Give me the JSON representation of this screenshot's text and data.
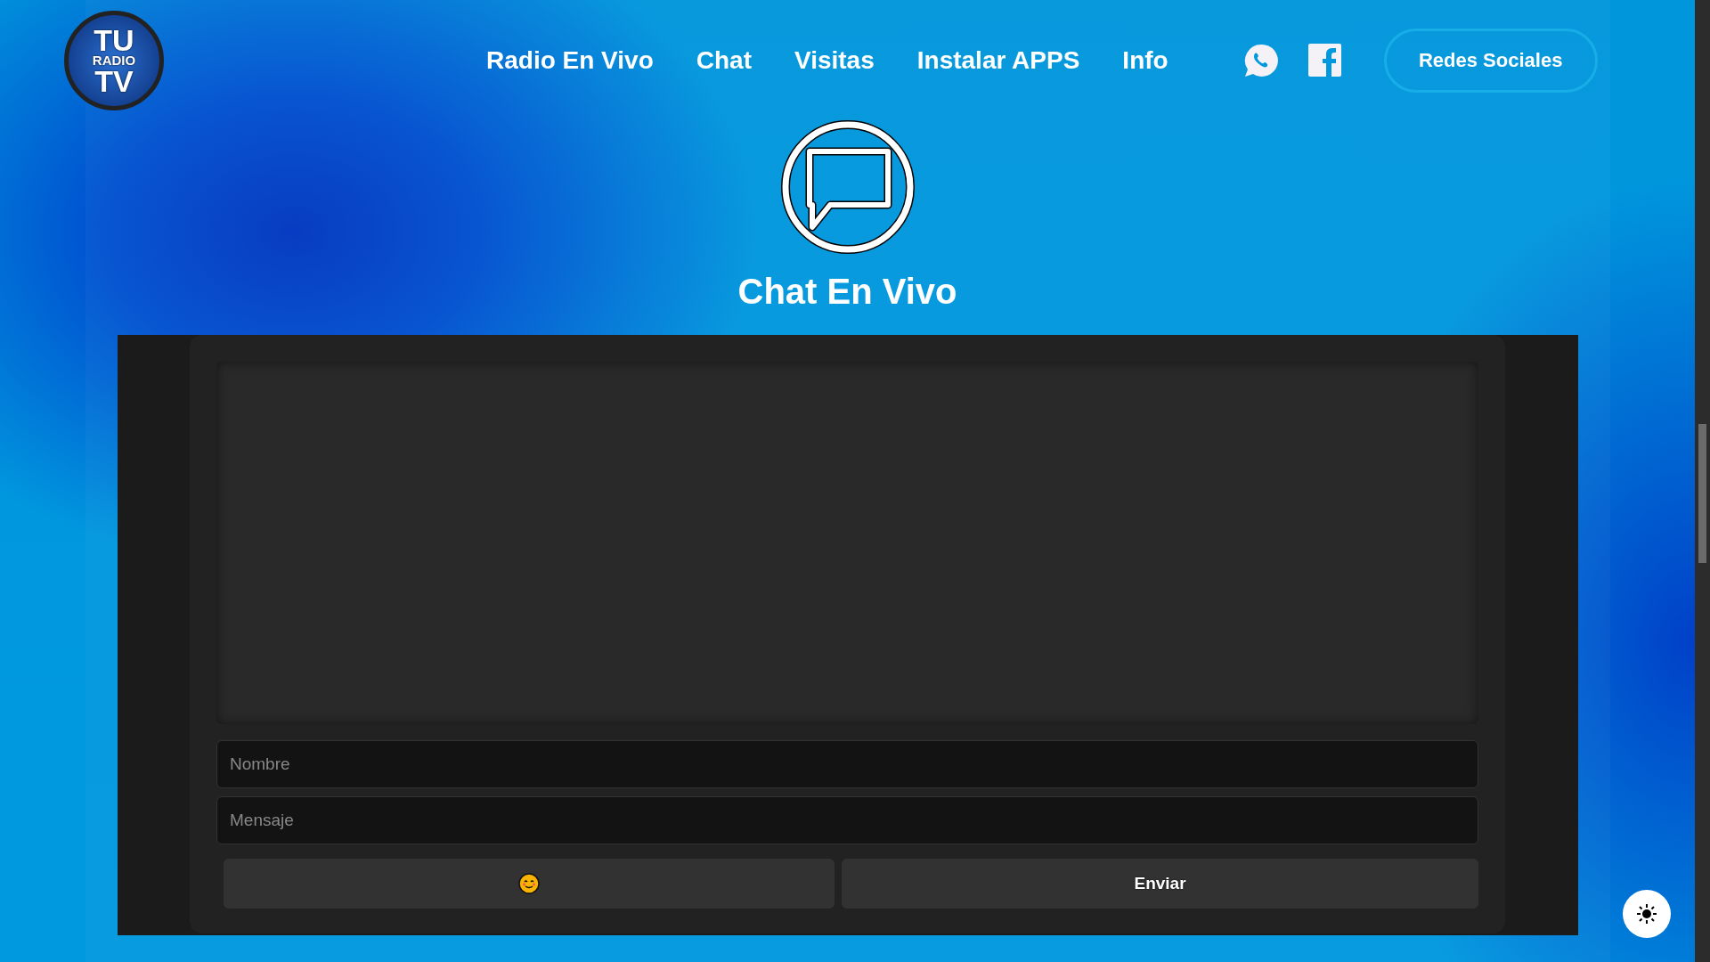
{
  "logo": {
    "lines": [
      "TU",
      "RADIO",
      "TV"
    ]
  },
  "nav": {
    "items": [
      {
        "label": "Radio En Vivo"
      },
      {
        "label": "Chat"
      },
      {
        "label": "Visitas"
      },
      {
        "label": "Instalar APPS"
      },
      {
        "label": "Info"
      }
    ],
    "social_button": "Redes Sociales"
  },
  "section": {
    "title": "Chat En Vivo"
  },
  "chat": {
    "name_field": {
      "placeholder": "Nombre"
    },
    "message_field": {
      "placeholder": "Mensaje"
    },
    "send_button": "Enviar"
  }
}
